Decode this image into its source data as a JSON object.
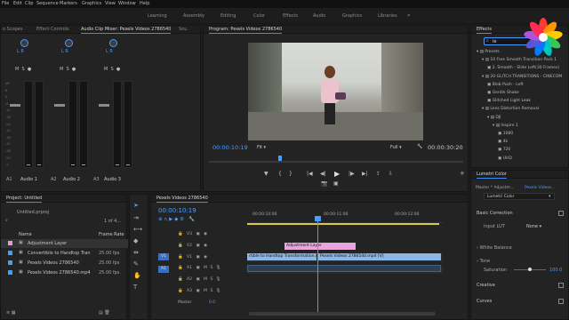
{
  "menu": [
    "File",
    "Edit",
    "Clip",
    "Sequence",
    "Markers",
    "Graphics",
    "View",
    "Window",
    "Help"
  ],
  "workspaces": [
    {
      "label": "Learning",
      "active": false
    },
    {
      "label": "Assembly",
      "active": false
    },
    {
      "label": "Editing",
      "active": false
    },
    {
      "label": "Color",
      "active": false
    },
    {
      "label": "Effects",
      "active": false
    },
    {
      "label": "Audio",
      "active": false
    },
    {
      "label": "Graphics",
      "active": false
    },
    {
      "label": "Libraries",
      "active": false
    }
  ],
  "mixer": {
    "tabs": [
      "o Scopes",
      "Effect Controls",
      "Audio Clip Mixer: Pexels Videos 2786540",
      "Sou"
    ],
    "channels": [
      "A1",
      "A2",
      "A3"
    ],
    "labels": [
      "Audio 1",
      "Audio 2",
      "Audio 3"
    ],
    "l_r": "L  R",
    "db_scale": [
      "dB",
      "6",
      "0",
      "-6",
      "-12",
      "-18",
      "-24",
      "-30",
      "-36",
      "-42",
      "-48",
      "-54",
      "-∞"
    ]
  },
  "program": {
    "title": "Program: Pexels Videos 2786540",
    "timecode": "00:00:10:19",
    "fit": "Fit",
    "quality": "Full",
    "duration": "00:00:30:20"
  },
  "effects": {
    "title": "Effects",
    "search_value": "le",
    "tree": [
      {
        "level": 0,
        "label": "Presets"
      },
      {
        "level": 1,
        "label": "10 Free Smooth Transition Pack 1"
      },
      {
        "level": 2,
        "label": "2. Smooth - Slide Left(30 Frames)"
      },
      {
        "level": 1,
        "label": "20 GLITCH TRANSITIONS - CINECOM"
      },
      {
        "level": 2,
        "label": "Blob Push - Left"
      },
      {
        "level": 2,
        "label": "Gentle Shake"
      },
      {
        "level": 2,
        "label": "Glitched Light Leak"
      },
      {
        "level": 1,
        "label": "Lens Distortion Removal"
      },
      {
        "level": 2,
        "label": "DJI"
      },
      {
        "level": 3,
        "label": "Inspire 1"
      },
      {
        "level": 4,
        "label": "1080"
      },
      {
        "level": 4,
        "label": "4k"
      },
      {
        "level": 4,
        "label": "720"
      },
      {
        "level": 4,
        "label": "UHD"
      }
    ]
  },
  "lumetri": {
    "title": "Lumetri Color",
    "master": "Master * Adjustm...",
    "clip": "Pexels Videos...",
    "lumetri_sel": "Lumetri Color",
    "basic": "Basic Correction",
    "input_lut": "Input LUT",
    "input_lut_val": "None",
    "white_balance": "White Balance",
    "tone": "Tone",
    "saturation": "Saturation",
    "saturation_val": "100.0",
    "saturation_pct": 0.5,
    "creative": "Creative",
    "curves": "Curves"
  },
  "project": {
    "title": "Project: Untitled",
    "file": "Untitled.prproj",
    "count": "1 of 4...",
    "col_name": "Name",
    "col_rate": "Frame Rate",
    "items": [
      {
        "name": "Adjustment Layer",
        "rate": "",
        "color": "#e59ad9"
      },
      {
        "name": "Convertible to Handtop Tran",
        "rate": "25.00 fps",
        "color": "#4aa0e8"
      },
      {
        "name": "Pexels Videos 2786540",
        "rate": "25.00 fps",
        "color": "#4aa0e8"
      },
      {
        "name": "Pexels Videos 2786540.mp4",
        "rate": "25.00 fps",
        "color": "#4aa0e8"
      }
    ]
  },
  "timeline": {
    "title": "Pexels Videos 2786540",
    "timecode": "00:00:10:19",
    "ticks": [
      "00:00:10:00",
      "00:00:11:00",
      "00:00:12:00"
    ],
    "tracks_v": [
      "V3",
      "V2",
      "V1"
    ],
    "tracks_a": [
      "A1",
      "A2",
      "A3"
    ],
    "master": "Master",
    "master_val": "0.0",
    "v1_source": "V1",
    "a1_source": "A1",
    "clips": {
      "adjustment": "Adjustment Layer",
      "v1_left": "rtible to Handtop Transformation.mp4 [V]",
      "v1_right": "Pexels Videos 2786540.mp4 [V]"
    }
  }
}
